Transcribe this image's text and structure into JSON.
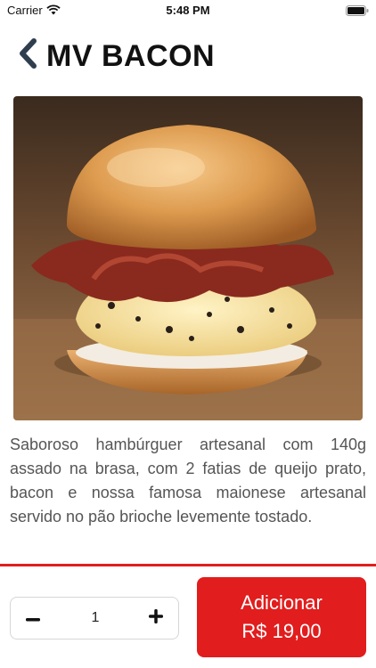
{
  "status_bar": {
    "carrier": "Carrier",
    "time": "5:48 PM",
    "icons": [
      "wifi-icon",
      "battery-icon"
    ]
  },
  "nav": {
    "back_icon": "chevron-left-icon",
    "title": "MV BACON"
  },
  "product": {
    "image_icon": "burger-photo",
    "description": "Saboroso hambúrguer artesanal com 140g assado na brasa, com 2 fatias de queijo prato, bacon e nossa famosa maionese artesanal servido no pão brioche levemente tostado."
  },
  "order": {
    "quantity": "1",
    "minus_icon": "minus-icon",
    "plus_icon": "plus-icon",
    "add_label": "Adicionar",
    "add_price": "R$ 19,00"
  },
  "colors": {
    "accent": "#e21d1d",
    "nav_chevron": "#2f3e4f",
    "description_text": "#555555"
  }
}
